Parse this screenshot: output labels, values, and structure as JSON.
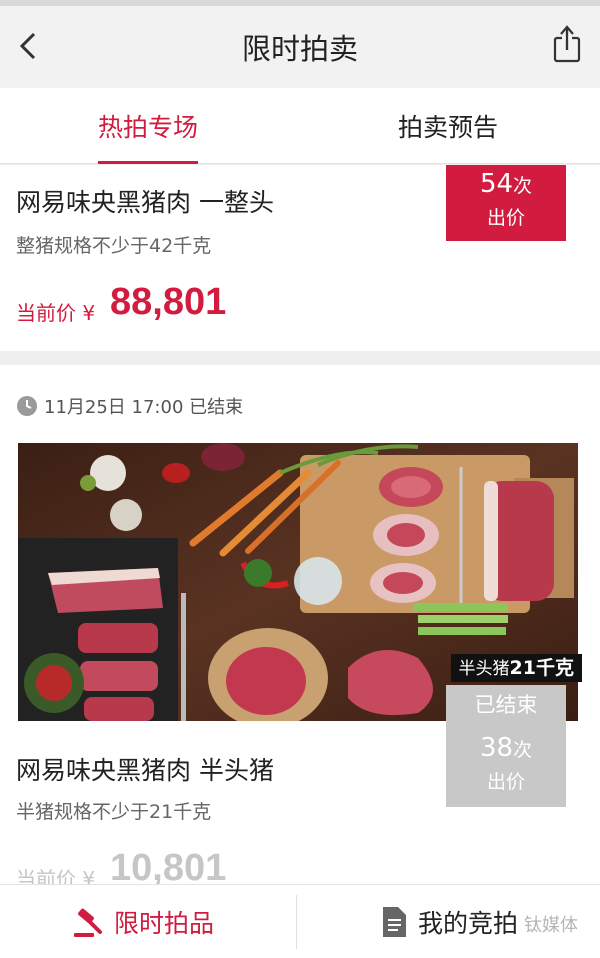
{
  "navbar": {
    "title": "限时拍卖",
    "back_icon": "chevron-left-icon",
    "share_icon": "share-icon"
  },
  "tabs": {
    "hot": "热拍专场",
    "preview": "拍卖预告",
    "active": "hot"
  },
  "items": [
    {
      "title": "网易味央黑猪肉 一整头",
      "spec": "整猪规格不少于42千克",
      "price_label": "当前价 ¥",
      "price": "88,801",
      "bid_count": "54",
      "bid_unit": "次",
      "bid_label": "出价"
    },
    {
      "time": "11月25日 17:00 已结束",
      "weight_prefix": "半头猪",
      "weight_value": "21千克",
      "ended_label": "已结束",
      "title": "网易味央黑猪肉 半头猪",
      "spec": "半猪规格不少于21千克",
      "price_label": "当前价 ¥",
      "price": "10,801",
      "bid_count": "38",
      "bid_unit": "次",
      "bid_label": "出价"
    }
  ],
  "tabbar": {
    "auction": "限时拍品",
    "mine": "我的竞拍",
    "auction_icon": "gavel-icon",
    "mine_icon": "document-icon",
    "watermark": "钛媒体"
  },
  "colors": {
    "accent": "#d21c3f",
    "ended_gray": "#c8c8c8"
  }
}
